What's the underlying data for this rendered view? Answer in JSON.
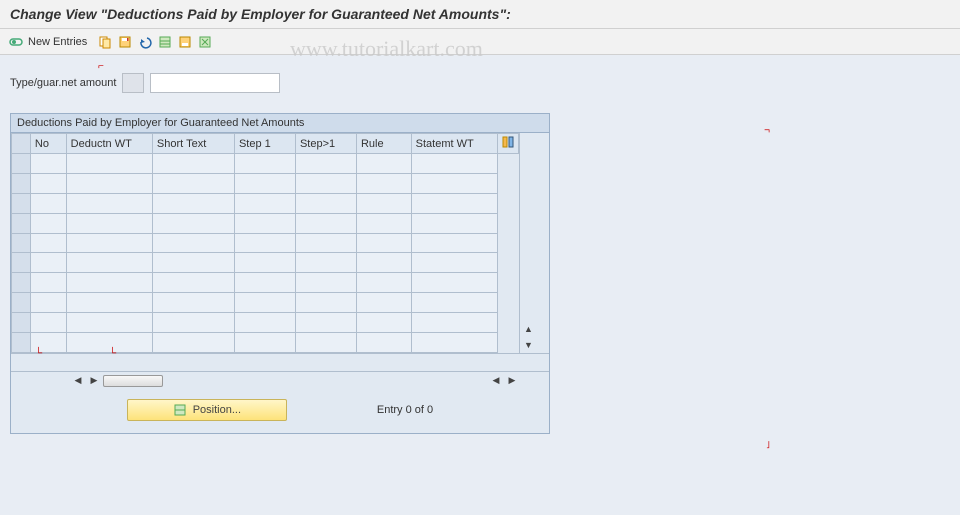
{
  "title": "Change View \"Deductions Paid by Employer for Guaranteed Net Amounts\":",
  "watermark": "www.tutorialkart.com",
  "toolbar": {
    "new_entries_label": "New Entries",
    "icons": {
      "toggle": "toggle-icon",
      "copy": "copy-icon",
      "save": "save-icon",
      "undo": "undo-icon",
      "select_all": "select-all-icon",
      "save_variant": "save-variant-icon",
      "deselect": "deselect-icon"
    }
  },
  "filter": {
    "label": "Type/guar.net amount",
    "small_value": "",
    "text_value": ""
  },
  "grid": {
    "title": "Deductions Paid by Employer for Guaranteed Net Amounts",
    "columns": [
      "No",
      "Deductn WT",
      "Short Text",
      "Step 1",
      "Step>1",
      "Rule",
      "Statemt WT"
    ],
    "rows": 10
  },
  "footer": {
    "position_label": "Position...",
    "entry_text": "Entry 0 of 0"
  }
}
